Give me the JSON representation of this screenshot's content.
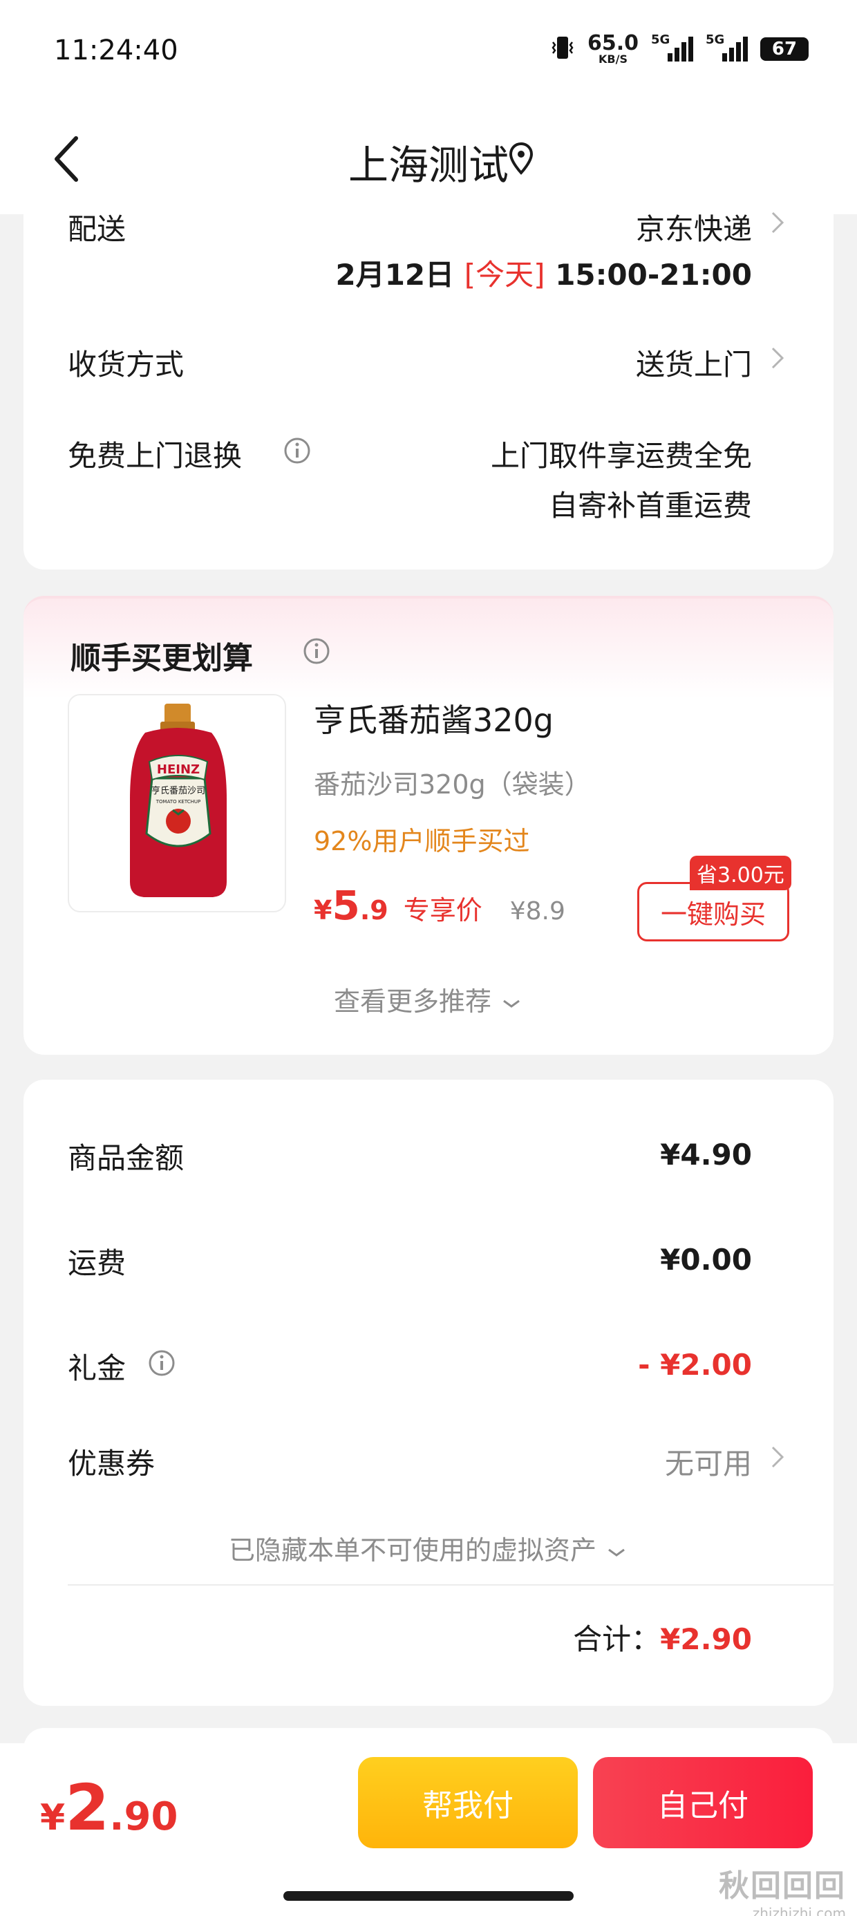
{
  "status_bar": {
    "time": "11:24:40",
    "net_speed": "65.0",
    "net_unit": "KB/S",
    "signal1_label": "5G",
    "signal2_label": "5G",
    "battery": "67"
  },
  "header": {
    "title": "上海测试",
    "back_icon": "chevron-left-icon",
    "location_icon": "location-pin-icon"
  },
  "delivery": {
    "shipping_label": "配送",
    "carrier": "京东快递",
    "date": "2月12日",
    "today_tag": "[今天]",
    "time_window": "15:00-21:00",
    "receive_label": "收货方式",
    "receive_value": "送货上门",
    "return_label": "免费上门退换",
    "return_line1": "上门取件享运费全免",
    "return_line2": "自寄补首重运费"
  },
  "addon": {
    "title": "顺手买更划算",
    "product": {
      "name": "亨氏番茄酱320g",
      "spec": "番茄沙司320g（袋装）",
      "bought_rate": "92%用户顺手买过",
      "currency": "¥",
      "price_int": "5",
      "price_dec": ".9",
      "price_tag": "专享价",
      "original_price": "¥8.9",
      "save_badge": "省3.00元",
      "buy_button": "一键购买",
      "image_brand": "HEINZ",
      "image_cn": "亨氏番茄沙司",
      "image_en": "TOMATO KETCHUP"
    },
    "more_link": "查看更多推荐"
  },
  "summary": {
    "goods_label": "商品金额",
    "goods_value": "¥4.90",
    "shipping_label": "运费",
    "shipping_value": "¥0.00",
    "gift_label": "礼金",
    "gift_value": "- ¥2.00",
    "coupon_label": "优惠券",
    "coupon_value": "无可用",
    "hidden_assets": "已隐藏本单不可使用的虚拟资产",
    "total_label": "合计：",
    "total_value": "¥2.90"
  },
  "bottom_bar": {
    "currency": "¥",
    "total_int": "2",
    "total_dec": ".90",
    "help_pay": "帮我付",
    "self_pay": "自己付"
  },
  "watermark": {
    "line1": "秋回回回",
    "line2": "zhizhizhi.com"
  },
  "colors": {
    "accent_red": "#e8322e",
    "accent_orange": "#e3861c",
    "help_button": "#ffbf12",
    "self_button": "#fa2a44"
  }
}
